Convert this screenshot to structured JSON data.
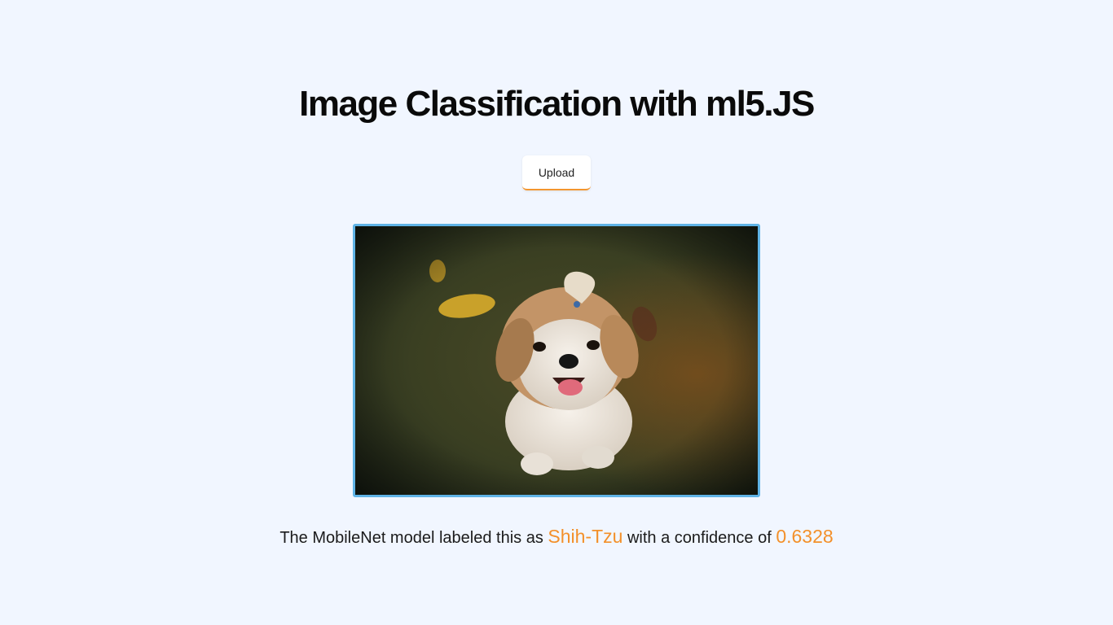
{
  "page": {
    "title": "Image Classification with ml5.JS"
  },
  "upload": {
    "label": "Upload"
  },
  "image": {
    "alt": "Shih-Tzu puppy sitting on grass"
  },
  "result": {
    "prefix": "The MobileNet model labeled this as ",
    "label": "Shih-Tzu",
    "middle": " with a confidence of ",
    "confidence": "0.6328"
  },
  "colors": {
    "background": "#f1f6ff",
    "accent": "#f3902a",
    "frame_border": "#5fb3e6"
  }
}
